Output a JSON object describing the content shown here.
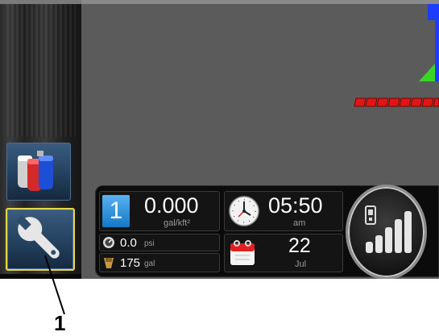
{
  "sidebar": {
    "products_button": {
      "icon": "product-tanks-icon"
    },
    "setup_button": {
      "icon": "wrench-icon",
      "highlight_color": "#e8d74a"
    }
  },
  "map": {
    "swath_color": "#e01515",
    "marker_color": "#1e3cff",
    "vehicle_color": "#39d623"
  },
  "status": {
    "boom_number": "1",
    "rate_value": "0.000",
    "rate_unit": "gal/kft²",
    "pressure_value": "0.0",
    "pressure_unit": "psi",
    "volume_value": "175",
    "volume_unit": "gal",
    "time_value": "05:50",
    "time_period": "am",
    "date_day": "22",
    "date_month": "Jul",
    "icons": [
      "clock-icon",
      "calendar-icon",
      "pressure-gauge-icon",
      "tank-volume-icon",
      "phone-signal-icon"
    ]
  },
  "callout": {
    "label": "1"
  },
  "colors": {
    "accent": "#1e8fe0",
    "screen_bg": "#5a5b5a",
    "panel_bg": "#0b0b0b"
  }
}
